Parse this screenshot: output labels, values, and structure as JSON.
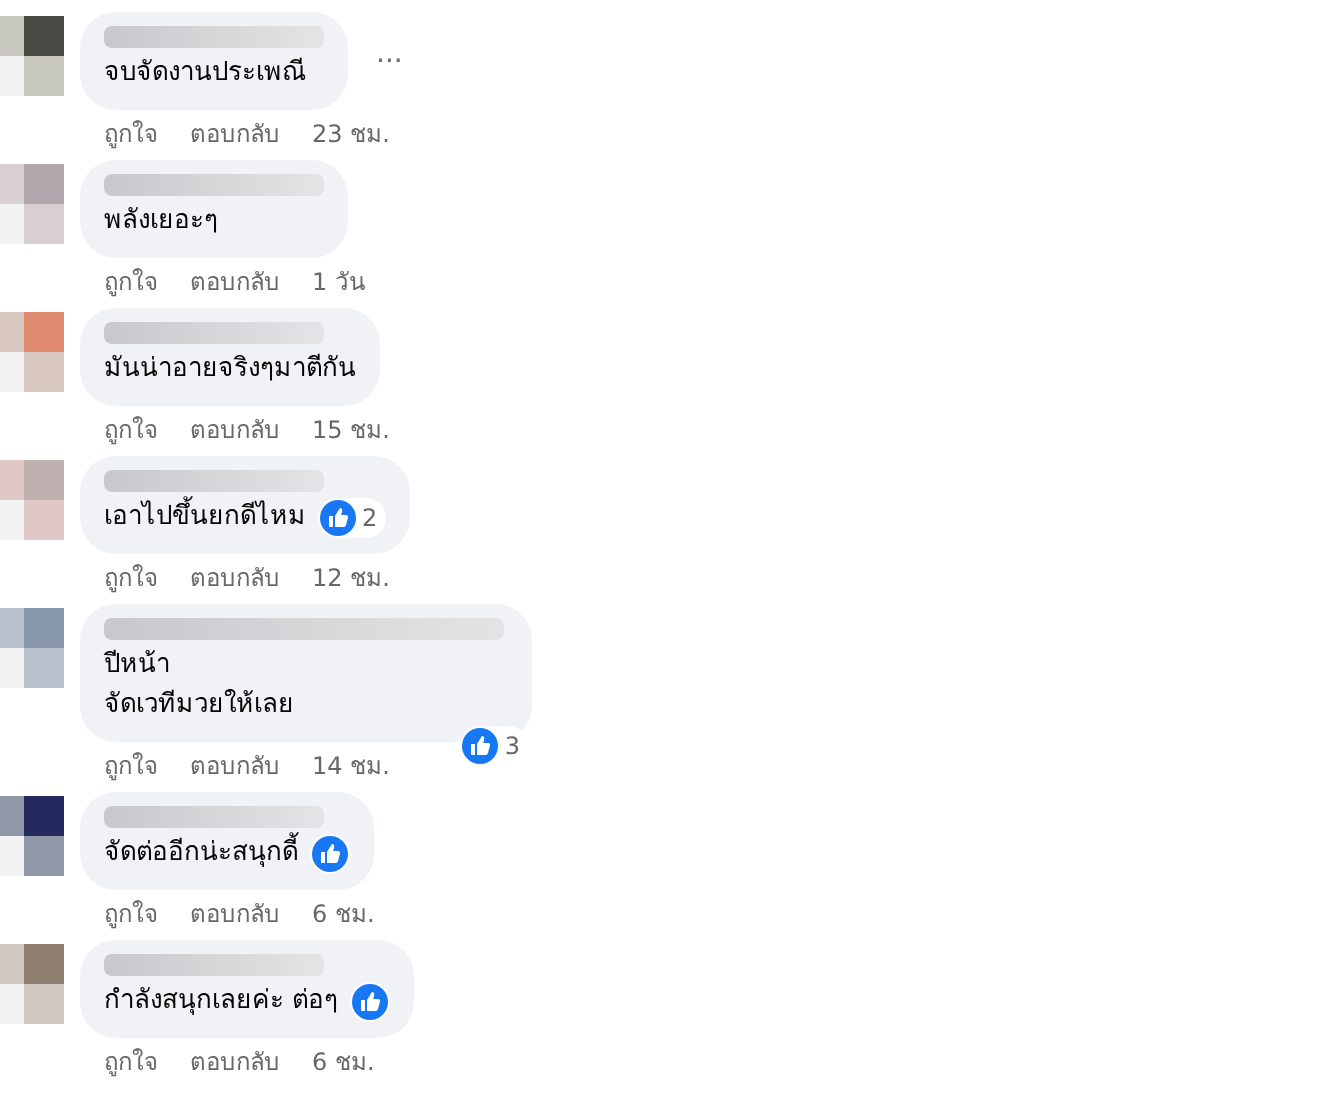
{
  "comments": [
    {
      "text": "จบจัดงานประเพณี",
      "more": "···",
      "like": "ถูกใจ",
      "reply": "ตอบกลับ",
      "time": "23 ชม."
    },
    {
      "text": "พลังเยอะๆ",
      "like": "ถูกใจ",
      "reply": "ตอบกลับ",
      "time": "1 วัน"
    },
    {
      "text": "มันน่าอายจริงๆมาตีกัน",
      "like": "ถูกใจ",
      "reply": "ตอบกลับ",
      "time": "15 ชม."
    },
    {
      "text": "เอาไปขึ้นยกดีไหม",
      "reaction": {
        "count": "2",
        "kind": "inline"
      },
      "like": "ถูกใจ",
      "reply": "ตอบกลับ",
      "time": "12 ชม."
    },
    {
      "text": "ปีหน้า\nจัดเวทีมวยให้เลย",
      "reaction": {
        "count": "3",
        "kind": "corner"
      },
      "like": "ถูกใจ",
      "reply": "ตอบกลับ",
      "time": "14 ชม."
    },
    {
      "text": "จัดต่ออีกน่ะสนุกดี้",
      "reaction": {
        "kind": "inline"
      },
      "like": "ถูกใจ",
      "reply": "ตอบกลับ",
      "time": "6 ชม."
    },
    {
      "text": "กำลังสนุกเลยค่ะ ต่อๆ",
      "reaction": {
        "kind": "inline"
      },
      "like": "ถูกใจ",
      "reply": "ตอบกลับ",
      "time": "6 ชม."
    }
  ]
}
